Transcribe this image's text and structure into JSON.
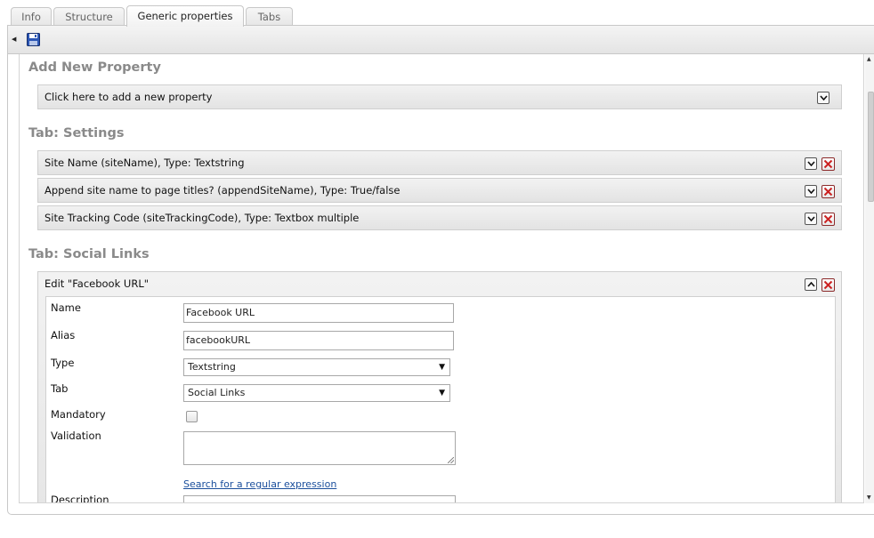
{
  "tabs": [
    {
      "label": "Info"
    },
    {
      "label": "Structure"
    },
    {
      "label": "Generic properties"
    },
    {
      "label": "Tabs"
    }
  ],
  "active_tab": "Generic properties",
  "toolbar": {
    "save_icon": "save-icon"
  },
  "add_section": {
    "title": "Add New Property",
    "row_label": "Click here to add a new property"
  },
  "settings_section": {
    "title": "Tab: Settings",
    "rows": [
      {
        "label": "Site Name (siteName), Type: Textstring"
      },
      {
        "label": "Append site name to page titles? (appendSiteName), Type: True/false"
      },
      {
        "label": "Site Tracking Code (siteTrackingCode), Type: Textbox multiple"
      }
    ]
  },
  "social_section": {
    "title": "Tab: Social Links",
    "edit_header": "Edit \"Facebook URL\"",
    "form": {
      "name_label": "Name",
      "name_value": "Facebook URL",
      "alias_label": "Alias",
      "alias_value": "facebookURL",
      "type_label": "Type",
      "type_value": "Textstring",
      "tab_label": "Tab",
      "tab_value": "Social Links",
      "mandatory_label": "Mandatory",
      "mandatory_checked": false,
      "validation_label": "Validation",
      "validation_value": "",
      "regex_link": "Search for a regular expression",
      "description_label": "Description"
    }
  },
  "colors": {
    "section_title": "#8a8a8a",
    "link": "#1b4f9c",
    "delete_red": "#cc2222"
  }
}
